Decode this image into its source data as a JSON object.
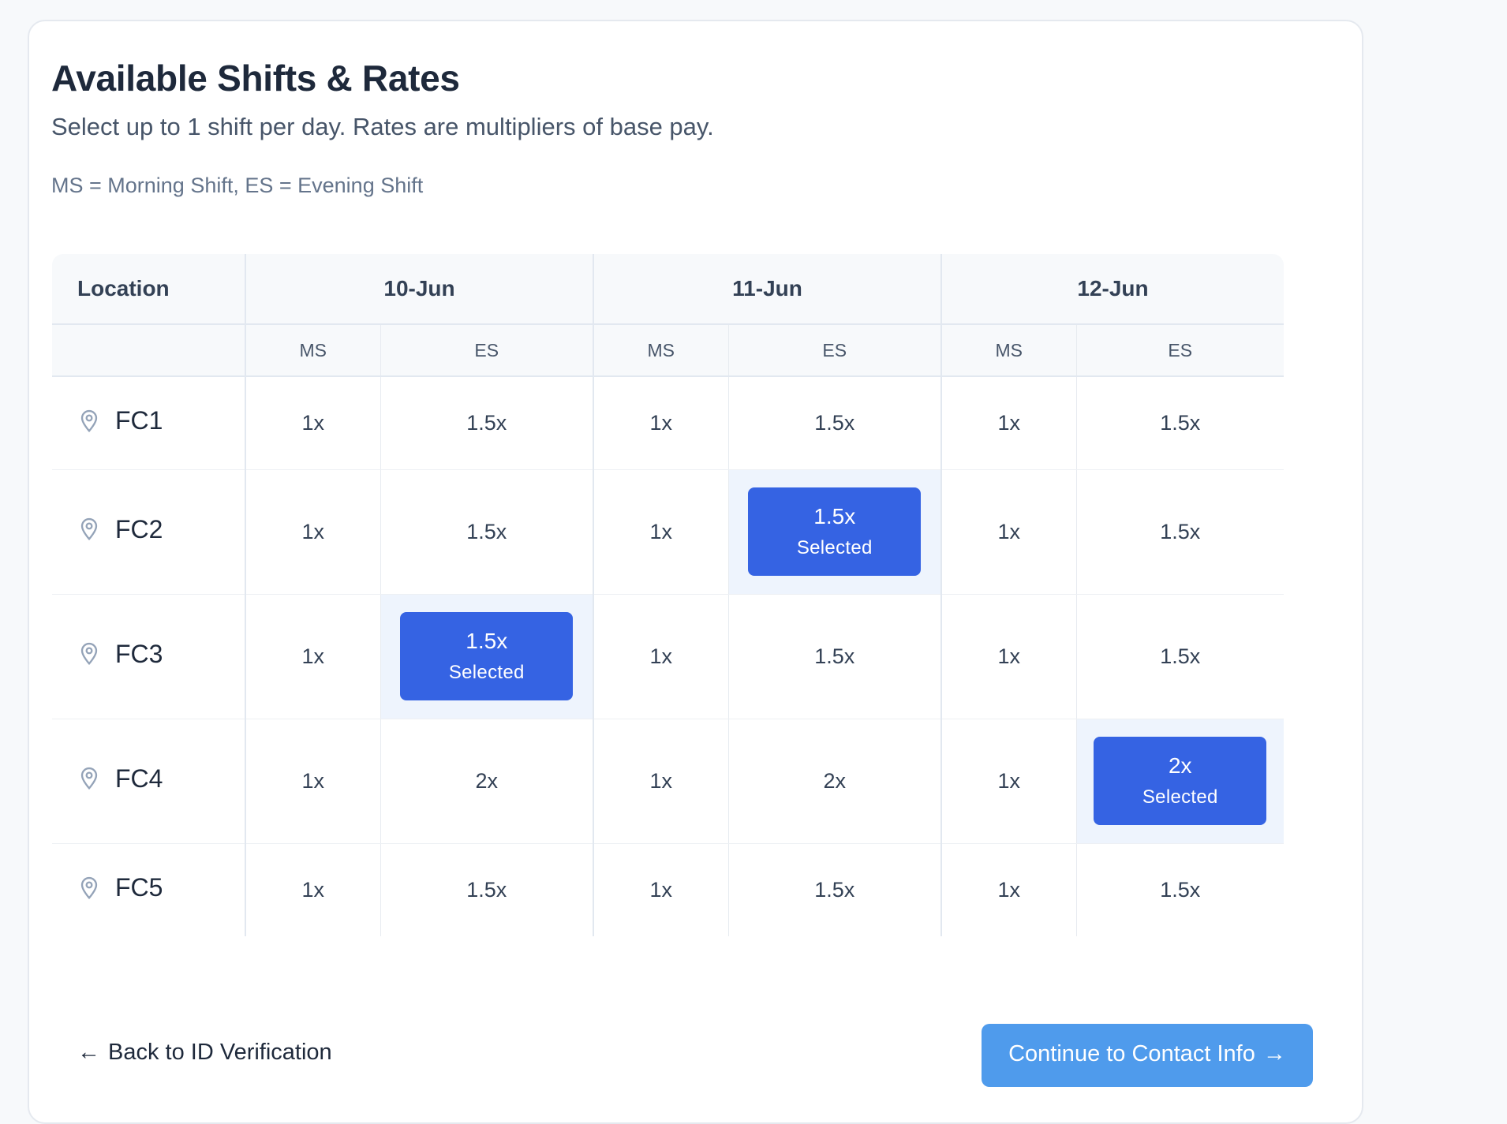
{
  "page": {
    "title": "Available Shifts & Rates",
    "subtitle": "Select up to 1 shift per day. Rates are multipliers of base pay.",
    "legend": "MS = Morning Shift, ES = Evening Shift"
  },
  "table": {
    "location_header": "Location",
    "dates": [
      "10-Jun",
      "11-Jun",
      "12-Jun"
    ],
    "shift_labels": [
      "MS",
      "ES",
      "MS",
      "ES",
      "MS",
      "ES"
    ],
    "selected_label": "Selected",
    "location_icon": "map-pin-icon",
    "rows": [
      {
        "location": "FC1",
        "rates": [
          "1x",
          "1.5x",
          "1x",
          "1.5x",
          "1x",
          "1.5x"
        ],
        "selected": null
      },
      {
        "location": "FC2",
        "rates": [
          "1x",
          "1.5x",
          "1x",
          "1.5x",
          "1x",
          "1.5x"
        ],
        "selected": 3
      },
      {
        "location": "FC3",
        "rates": [
          "1x",
          "1.5x",
          "1x",
          "1.5x",
          "1x",
          "1.5x"
        ],
        "selected": 1
      },
      {
        "location": "FC4",
        "rates": [
          "1x",
          "2x",
          "1x",
          "2x",
          "1x",
          "2x"
        ],
        "selected": 5
      },
      {
        "location": "FC5",
        "rates": [
          "1x",
          "1.5x",
          "1x",
          "1.5x",
          "1x",
          "1.5x"
        ],
        "selected": null
      }
    ]
  },
  "nav": {
    "back_label": "Back to ID Verification",
    "back_arrow": "←",
    "continue_label": "Continue to Contact Info",
    "continue_arrow": "→"
  },
  "colors": {
    "accent": "#3563e3",
    "selected_cell_bg": "#eef4fd",
    "continue_bg": "#4f9bec"
  }
}
